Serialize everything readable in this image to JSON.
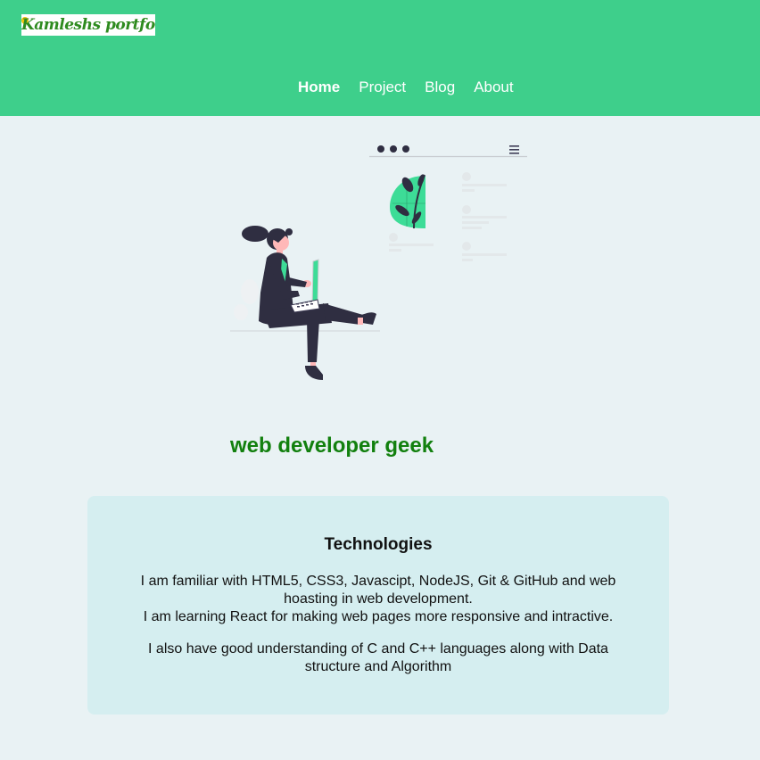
{
  "header": {
    "logo_text": "Kamleshs portfolio",
    "nav": [
      {
        "label": "Home",
        "active": true
      },
      {
        "label": "Project",
        "active": false
      },
      {
        "label": "Blog",
        "active": false
      },
      {
        "label": "About",
        "active": false
      }
    ]
  },
  "hero": {
    "illustration": "woman-with-laptop-illustration",
    "tagline": "web developer geek"
  },
  "technologies": {
    "title": "Technologies",
    "para1_line1": "I am familiar with HTML5, CSS3, Javascipt, NodeJS, Git & GitHub and web hoasting in web development.",
    "para1_line2": "I am learning React for making web pages more responsive and intractive.",
    "para2": "I also have good understanding of C and C++ languages along with Data structure and Algorithm"
  },
  "colors": {
    "header_bg": "#3ecf8b",
    "page_bg": "#e9f2f4",
    "card_bg": "#d5eef0",
    "tagline": "#12800e",
    "illustration_accent": "#3ddc97"
  }
}
